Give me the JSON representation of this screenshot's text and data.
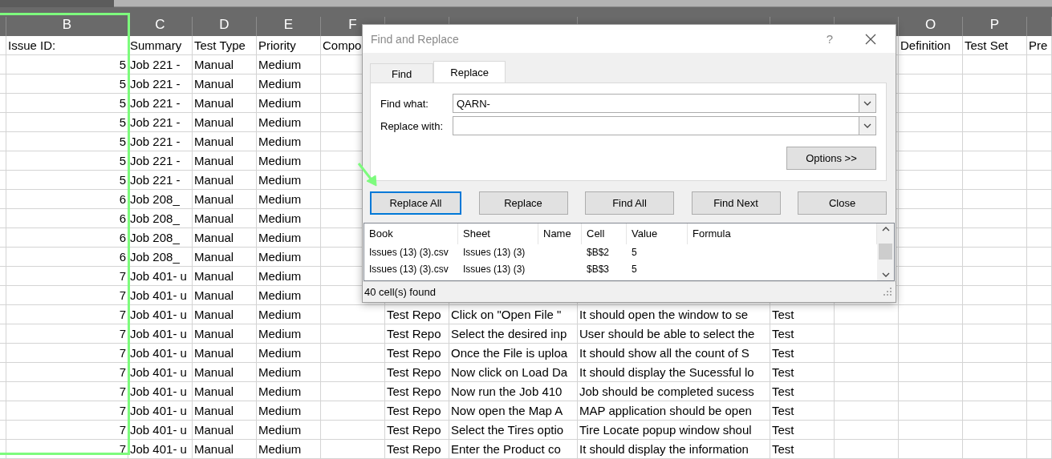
{
  "sheet": {
    "columns": [
      {
        "letter": "B",
        "heading": "Issue ID:"
      },
      {
        "letter": "C",
        "heading": "Summary"
      },
      {
        "letter": "D",
        "heading": "Test Type"
      },
      {
        "letter": "E",
        "heading": "Priority"
      },
      {
        "letter": "F",
        "heading": "Compo"
      },
      {
        "letter": "O",
        "heading": "Definition"
      },
      {
        "letter": "P",
        "heading": "Test Set"
      },
      {
        "heading": "Pre"
      }
    ],
    "rows": [
      {
        "issue_id": "5",
        "summary": "Job 221 -",
        "test_type": "Manual",
        "priority": "Medium"
      },
      {
        "issue_id": "5",
        "summary": "Job 221 -",
        "test_type": "Manual",
        "priority": "Medium"
      },
      {
        "issue_id": "5",
        "summary": "Job 221 -",
        "test_type": "Manual",
        "priority": "Medium"
      },
      {
        "issue_id": "5",
        "summary": "Job 221 -",
        "test_type": "Manual",
        "priority": "Medium"
      },
      {
        "issue_id": "5",
        "summary": "Job 221 -",
        "test_type": "Manual",
        "priority": "Medium"
      },
      {
        "issue_id": "5",
        "summary": "Job 221 -",
        "test_type": "Manual",
        "priority": "Medium"
      },
      {
        "issue_id": "5",
        "summary": "Job 221 -",
        "test_type": "Manual",
        "priority": "Medium"
      },
      {
        "issue_id": "6",
        "summary": "Job 208_",
        "test_type": "Manual",
        "priority": "Medium"
      },
      {
        "issue_id": "6",
        "summary": "Job 208_",
        "test_type": "Manual",
        "priority": "Medium"
      },
      {
        "issue_id": "6",
        "summary": "Job 208_",
        "test_type": "Manual",
        "priority": "Medium"
      },
      {
        "issue_id": "6",
        "summary": "Job 208_",
        "test_type": "Manual",
        "priority": "Medium"
      },
      {
        "issue_id": "7",
        "summary": "Job 401- u",
        "test_type": "Manual",
        "priority": "Medium"
      },
      {
        "issue_id": "7",
        "summary": "Job 401- u",
        "test_type": "Manual",
        "priority": "Medium"
      },
      {
        "issue_id": "7",
        "summary": "Job 401- u",
        "test_type": "Manual",
        "priority": "Medium",
        "column_g": "Test Repo",
        "column_h": "Click on \"Open File \"",
        "column_i": "It should open the window to se",
        "column_j": "Test"
      },
      {
        "issue_id": "7",
        "summary": "Job 401- u",
        "test_type": "Manual",
        "priority": "Medium",
        "column_g": "Test Repo",
        "column_h": "Select the desired inp",
        "column_i": "User should be able to select the",
        "column_j": "Test"
      },
      {
        "issue_id": "7",
        "summary": "Job 401- u",
        "test_type": "Manual",
        "priority": "Medium",
        "column_g": "Test Repo",
        "column_h": "Once the File is uploa",
        "column_i": "It should show all the count of S",
        "column_j": "Test"
      },
      {
        "issue_id": "7",
        "summary": "Job 401- u",
        "test_type": "Manual",
        "priority": "Medium",
        "column_g": "Test Repo",
        "column_h": "Now click on Load Da",
        "column_i": "It should display the Sucessful lo",
        "column_j": "Test"
      },
      {
        "issue_id": "7",
        "summary": "Job 401- u",
        "test_type": "Manual",
        "priority": "Medium",
        "column_g": "Test Repo",
        "column_h": "Now run the Job 410",
        "column_i": "Job should be completed sucess",
        "column_j": "Test"
      },
      {
        "issue_id": "7",
        "summary": "Job 401- u",
        "test_type": "Manual",
        "priority": "Medium",
        "column_g": "Test Repo",
        "column_h": "Now open the Map A",
        "column_i": "MAP application should be open",
        "column_j": "Test"
      },
      {
        "issue_id": "7",
        "summary": "Job 401- u",
        "test_type": "Manual",
        "priority": "Medium",
        "column_g": "Test Repo",
        "column_h": "Select the Tires optio",
        "column_i": "Tire Locate popup window shoul",
        "column_j": "Test"
      },
      {
        "issue_id": "7",
        "summary": "Job 401- u",
        "test_type": "Manual",
        "priority": "Medium",
        "column_g": "Test Repo",
        "column_h": "Enter the Product co",
        "column_i": "It should display the information",
        "column_j": "Test"
      }
    ]
  },
  "dialog": {
    "title": "Find and Replace",
    "help": "?",
    "tabs": [
      {
        "label": "Find",
        "selected": false
      },
      {
        "label": "Replace",
        "selected": true
      }
    ],
    "find_what": {
      "label": "Find what:",
      "value": "QARN-"
    },
    "replace_with": {
      "label": "Replace with:"
    },
    "options_button": "Options >>",
    "buttons": [
      {
        "label": "Replace All",
        "focused": true
      },
      {
        "label": "Replace",
        "focused": false
      },
      {
        "label": "Find All",
        "focused": false
      },
      {
        "label": "Find Next",
        "focused": false
      },
      {
        "label": "Close",
        "focused": false
      }
    ],
    "results": {
      "columns": [
        "Book",
        "Sheet",
        "Name",
        "Cell",
        "Value",
        "Formula"
      ],
      "rows": [
        {
          "book": "Issues (13) (3).csv",
          "sheet": "Issues (13) (3)",
          "cell": "$B$2",
          "value": "5"
        },
        {
          "book": "Issues (13) (3).csv",
          "sheet": "Issues (13) (3)",
          "cell": "$B$3",
          "value": "5"
        }
      ]
    },
    "status": "40 cell(s) found"
  }
}
